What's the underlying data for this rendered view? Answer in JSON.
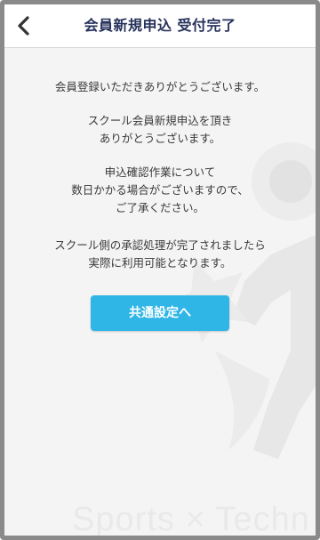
{
  "header": {
    "title": "会員新規申込 受付完了",
    "back_icon": "chevron-left-icon"
  },
  "message": {
    "line1": "会員登録いただきありがとうございます。",
    "line2a": "スクール会員新規申込を頂き",
    "line2b": "ありがとうございます。",
    "line3a": "申込確認作業について",
    "line3b": "数日かかる場合がございますので、",
    "line3c": "ご了承ください。",
    "line4a": "スクール側の承認処理が完了されましたら",
    "line4b": "実際に利用可能となります。"
  },
  "actions": {
    "common_settings_label": "共通設定へ"
  },
  "watermark": {
    "text": "Sports × Techn"
  },
  "colors": {
    "title": "#27325c",
    "button": "#2fb6e6",
    "background": "#f4f4f4",
    "frame": "#8a8a8a"
  }
}
